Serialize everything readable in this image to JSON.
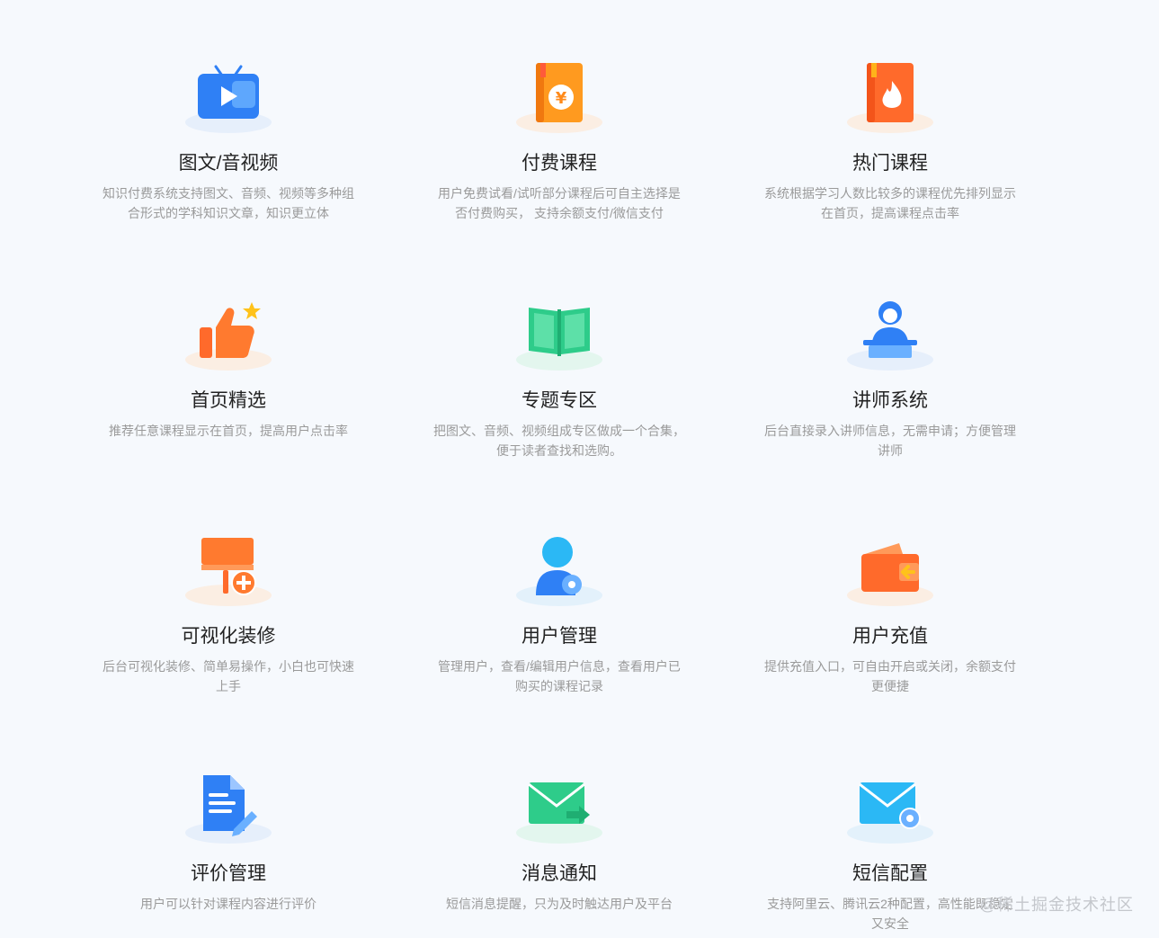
{
  "features": [
    {
      "title": "图文/音视频",
      "desc": "知识付费系统支持图文、音频、视频等多种组合形式的学科知识文章，知识更立体",
      "icon": "video-tv-icon"
    },
    {
      "title": "付费课程",
      "desc": "用户免费试看/试听部分课程后可自主选择是否付费购买， 支持余额支付/微信支付",
      "icon": "paid-book-icon"
    },
    {
      "title": "热门课程",
      "desc": "系统根据学习人数比较多的课程优先排列显示在首页，提高课程点击率",
      "icon": "hot-book-icon"
    },
    {
      "title": "首页精选",
      "desc": "推荐任意课程显示在首页，提高用户点击率",
      "icon": "thumbs-up-icon"
    },
    {
      "title": "专题专区",
      "desc": "把图文、音频、视频组成专区做成一个合集，便于读者查找和选购。",
      "icon": "open-book-icon"
    },
    {
      "title": "讲师系统",
      "desc": "后台直接录入讲师信息，无需申请；方便管理讲师",
      "icon": "lecturer-icon"
    },
    {
      "title": "可视化装修",
      "desc": "后台可视化装修、简单易操作，小白也可快速上手",
      "icon": "paint-roller-icon"
    },
    {
      "title": "用户管理",
      "desc": "管理用户，查看/编辑用户信息，查看用户已购买的课程记录",
      "icon": "user-gear-icon"
    },
    {
      "title": "用户充值",
      "desc": "提供充值入口，可自由开启或关闭，余额支付更便捷",
      "icon": "wallet-icon"
    },
    {
      "title": "评价管理",
      "desc": "用户可以针对课程内容进行评价",
      "icon": "document-edit-icon"
    },
    {
      "title": "消息通知",
      "desc": "短信消息提醒，只为及时触达用户及平台",
      "icon": "mail-send-icon"
    },
    {
      "title": "短信配置",
      "desc": "支持阿里云、腾讯云2种配置，高性能既稳定又安全",
      "icon": "mail-gear-icon"
    }
  ],
  "watermark": "@稀土掘金技术社区",
  "colors": {
    "title": "#222222",
    "desc": "#9a9a9a",
    "blue": "#2f80f5",
    "orange": "#ff7a2f",
    "green": "#2ecc8a"
  }
}
